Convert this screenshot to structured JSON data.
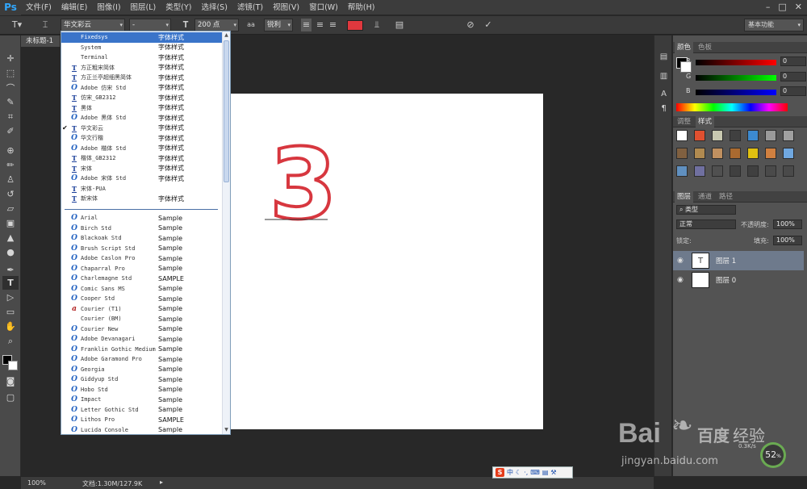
{
  "app": {
    "logo": "Ps"
  },
  "menu": [
    "文件(F)",
    "编辑(E)",
    "图像(I)",
    "图层(L)",
    "类型(Y)",
    "选择(S)",
    "滤镜(T)",
    "视图(V)",
    "窗口(W)",
    "帮助(H)"
  ],
  "options": {
    "font_family": "华文彩云",
    "font_style": "-",
    "font_size": "200 点",
    "antialias_icon": "aa",
    "antialias": "锐利",
    "text_color": "#e0383e"
  },
  "workspace": "基本功能",
  "document": {
    "tab": "未标题-1",
    "zoom": "100%",
    "doc_size": "文档:1.30M/127.9K"
  },
  "canvas_text": "3",
  "font_list": {
    "recent": [
      {
        "name": "Fixedsys",
        "sample": "字体样式",
        "icon": "",
        "selected": true
      },
      {
        "name": "System",
        "sample": "字体样式",
        "icon": ""
      },
      {
        "name": "Terminal",
        "sample": "字体样式",
        "icon": ""
      },
      {
        "name": "方正粗宋简体",
        "sample": "字体样式",
        "icon": "tt"
      },
      {
        "name": "方正兰亭超细黑简体",
        "sample": "字体样式",
        "icon": "tt"
      },
      {
        "name": "Adobe 仿宋 Std",
        "sample": "字体样式",
        "icon": "o"
      },
      {
        "name": "仿宋_GB2312",
        "sample": "字体样式",
        "icon": "tt"
      },
      {
        "name": "黑体",
        "sample": "字体样式",
        "icon": "tt"
      },
      {
        "name": "Adobe 黑体 Std",
        "sample": "字体样式",
        "icon": "o"
      },
      {
        "name": "华文彩云",
        "sample": "字体样式",
        "icon": "tt",
        "checked": true
      },
      {
        "name": "华文行楷",
        "sample": "字体样式",
        "icon": "o"
      },
      {
        "name": "Adobe 楷体 Std",
        "sample": "字体样式",
        "icon": "o"
      },
      {
        "name": "楷体_GB2312",
        "sample": "字体样式",
        "icon": "tt"
      },
      {
        "name": "宋体",
        "sample": "字体样式",
        "icon": "tt"
      },
      {
        "name": "Adobe 宋体 Std",
        "sample": "字体样式",
        "icon": "o"
      },
      {
        "name": "宋体-PUA",
        "sample": "",
        "icon": "tt"
      },
      {
        "name": "新宋体",
        "sample": "字体样式",
        "icon": "tt"
      }
    ],
    "all": [
      {
        "name": "Arial",
        "sample": "Sample",
        "icon": "o"
      },
      {
        "name": "Birch Std",
        "sample": "Sample",
        "icon": "o"
      },
      {
        "name": "Blackoak Std",
        "sample": "Sample",
        "icon": "o"
      },
      {
        "name": "Brush Script Std",
        "sample": "Sample",
        "icon": "o"
      },
      {
        "name": "Adobe Caslon Pro",
        "sample": "Sample",
        "icon": "o"
      },
      {
        "name": "Chaparral Pro",
        "sample": "Sample",
        "icon": "o"
      },
      {
        "name": "Charlemagne Std",
        "sample": "SAMPLE",
        "icon": "o"
      },
      {
        "name": "Comic Sans MS",
        "sample": "Sample",
        "icon": "o"
      },
      {
        "name": "Cooper Std",
        "sample": "Sample",
        "icon": "o"
      },
      {
        "name": "Courier (T1)",
        "sample": "Sample",
        "icon": "a"
      },
      {
        "name": "Courier (BM)",
        "sample": "Sample",
        "icon": ""
      },
      {
        "name": "Courier New",
        "sample": "Sample",
        "icon": "o"
      },
      {
        "name": "Adobe Devanagari",
        "sample": "Sample",
        "icon": "o"
      },
      {
        "name": "Franklin Gothic Medium",
        "sample": "Sample",
        "icon": "o"
      },
      {
        "name": "Adobe Garamond Pro",
        "sample": "Sample",
        "icon": "o"
      },
      {
        "name": "Georgia",
        "sample": "Sample",
        "icon": "o"
      },
      {
        "name": "Giddyup Std",
        "sample": "Sample",
        "icon": "o"
      },
      {
        "name": "Hobo Std",
        "sample": "Sample",
        "icon": "o"
      },
      {
        "name": "Impact",
        "sample": "Sample",
        "icon": "o"
      },
      {
        "name": "Letter Gothic Std",
        "sample": "Sample",
        "icon": "o"
      },
      {
        "name": "Lithos Pro",
        "sample": "SAMPLE",
        "icon": "o"
      },
      {
        "name": "Lucida Console",
        "sample": "Sample",
        "icon": "o"
      }
    ]
  },
  "color_panel": {
    "tabs": [
      "颜色",
      "色板"
    ],
    "r_label": "R",
    "r": "0",
    "g_label": "G",
    "g": "0",
    "b_label": "B",
    "b": "0"
  },
  "styles_panel": {
    "tabs": [
      "调整",
      "样式"
    ]
  },
  "layers_panel": {
    "tabs": [
      "图层",
      "通道",
      "路径"
    ],
    "filter": "类型",
    "blend_mode": "正常",
    "opacity_label": "不透明度:",
    "opacity": "100%",
    "lock_label": "锁定:",
    "fill_label": "填充:",
    "fill": "100%",
    "layers": [
      {
        "name": "图层 1",
        "thumb": "T",
        "active": true
      },
      {
        "name": "图层 0",
        "thumb": ""
      }
    ]
  },
  "ime": {
    "s": "S",
    "lang": "中"
  },
  "watermark": {
    "brand": "Bai",
    "brand2": "百度",
    "site": "经验",
    "url": "jingyan.baidu.com",
    "percent": "52",
    "speed": "0.3K/s"
  },
  "colors": {
    "accent": "#3a74c9",
    "text_red": "#d7373f"
  }
}
